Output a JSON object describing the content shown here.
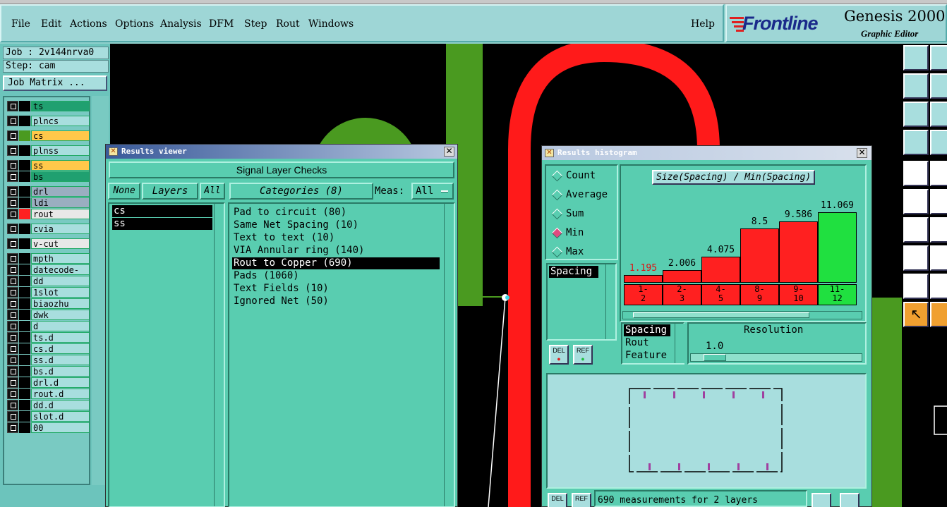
{
  "menu": {
    "items": [
      {
        "label": "File",
        "x": 0
      },
      {
        "label": "Edit"
      },
      {
        "label": "Actions"
      },
      {
        "label": "Options"
      },
      {
        "label": "Analysis"
      },
      {
        "label": "DFM"
      },
      {
        "label": "Step"
      },
      {
        "label": "Rout"
      },
      {
        "label": "Windows"
      }
    ],
    "help": "Help"
  },
  "brand": {
    "logo": "Frontline",
    "product": "Genesis 2000",
    "subtitle": "Graphic Editor"
  },
  "job": {
    "job_label": "Job : 2v144nrva0",
    "step_label": "Step: cam",
    "matrix_button": "Job Matrix ..."
  },
  "layers": [
    {
      "name": "ts",
      "swatch": "#000000",
      "fill": "#20a070"
    },
    {
      "name": "plncs",
      "swatch": "#000000",
      "fill": "#a8dede"
    },
    {
      "name": "cs",
      "swatch": "#4a9a20",
      "fill": "#ffc84a"
    },
    {
      "name": "plnss",
      "swatch": "#000000",
      "fill": "#a8dede"
    },
    {
      "name": "ss",
      "swatch": "#000000",
      "fill": "#ffc84a"
    },
    {
      "name": "bs",
      "swatch": "#000000",
      "fill": "#20a070"
    },
    {
      "name": "drl",
      "swatch": "#000000",
      "fill": "#9aaec0"
    },
    {
      "name": "ldi",
      "swatch": "#000000",
      "fill": "#9aaec0"
    },
    {
      "name": "rout",
      "swatch": "#ff2020",
      "fill": "#e8e8e8"
    },
    {
      "name": "cvia",
      "swatch": "#000000",
      "fill": "#a8dede"
    },
    {
      "name": "v-cut",
      "swatch": "#000000",
      "fill": "#e8e8e8"
    },
    {
      "name": "mpth",
      "swatch": "#000000",
      "fill": "#a8dede"
    },
    {
      "name": "datecode-ss",
      "swatch": "#000000",
      "fill": "#a8dede"
    },
    {
      "name": "dd",
      "swatch": "#000000",
      "fill": "#a8dede"
    },
    {
      "name": "1slot",
      "swatch": "#000000",
      "fill": "#a8dede"
    },
    {
      "name": "biaozhu",
      "swatch": "#000000",
      "fill": "#a8dede"
    },
    {
      "name": "dwk",
      "swatch": "#000000",
      "fill": "#a8dede"
    },
    {
      "name": "d",
      "swatch": "#000000",
      "fill": "#a8dede"
    },
    {
      "name": "ts.d",
      "swatch": "#000000",
      "fill": "#a8dede"
    },
    {
      "name": "cs.d",
      "swatch": "#000000",
      "fill": "#a8dede"
    },
    {
      "name": "ss.d",
      "swatch": "#000000",
      "fill": "#a8dede"
    },
    {
      "name": "bs.d",
      "swatch": "#000000",
      "fill": "#a8dede"
    },
    {
      "name": "drl.d",
      "swatch": "#000000",
      "fill": "#a8dede"
    },
    {
      "name": "rout.d",
      "swatch": "#000000",
      "fill": "#a8dede"
    },
    {
      "name": "dd.d",
      "swatch": "#000000",
      "fill": "#a8dede"
    },
    {
      "name": "slot.d",
      "swatch": "#000000",
      "fill": "#a8dede"
    },
    {
      "name": "00",
      "swatch": "#000000",
      "fill": "#a8dede"
    }
  ],
  "results_viewer": {
    "title": "Results viewer",
    "header": "Signal Layer Checks",
    "none_btn": "None",
    "layers_btn": "Layers",
    "all_btn": "All",
    "categories_btn": "Categories (8)",
    "meas_label": "Meas:",
    "meas_value": "All",
    "layer_items": [
      "cs",
      "ss"
    ],
    "categories": [
      "Pad to circuit (80)",
      "Same Net Spacing (10)",
      "Text to text (10)",
      "VIA Annular ring (140)",
      "Rout to Copper (690)",
      "Pads (1060)",
      "Text Fields (10)",
      "Ignored Net (50)"
    ],
    "selected_category": 4
  },
  "histogram": {
    "title": "Results histogram",
    "modes": [
      "Count",
      "Average",
      "Sum",
      "Min",
      "Max"
    ],
    "selected_mode": "Min",
    "chart_title": "Size(Spacing) / Min(Spacing)",
    "list_item": "Spacing",
    "bars": [
      {
        "range_top": "1-",
        "range_bottom": "2",
        "value": 1.195
      },
      {
        "range_top": "2-",
        "range_bottom": "3",
        "value": 2.006
      },
      {
        "range_top": "4-",
        "range_bottom": "5",
        "value": 4.075
      },
      {
        "range_top": "8-",
        "range_bottom": "9",
        "value": 8.5
      },
      {
        "range_top": "9-",
        "range_bottom": "10",
        "value": 9.586
      },
      {
        "range_top": "11-",
        "range_bottom": "12",
        "value": 11.069
      }
    ],
    "value_labels": [
      "1.195",
      "2.006",
      "4.075",
      "8.5",
      "9.586",
      "11.069"
    ],
    "max_value": 11.069,
    "attr_list": [
      "Spacing",
      "Rout",
      "Feature"
    ],
    "resolution_label": "Resolution",
    "resolution_value": "1.0",
    "del_label": "DEL",
    "ref_label": "REF",
    "status": "690 measurements for 2 layers"
  },
  "colors": {
    "teal_bg": "#59cdb0",
    "green_copper": "#4a9a20",
    "rout_red": "#ff1a1a",
    "bar_red": "#ff2020",
    "bar_green": "#20e040",
    "title_blue": "#3a5a9a"
  }
}
